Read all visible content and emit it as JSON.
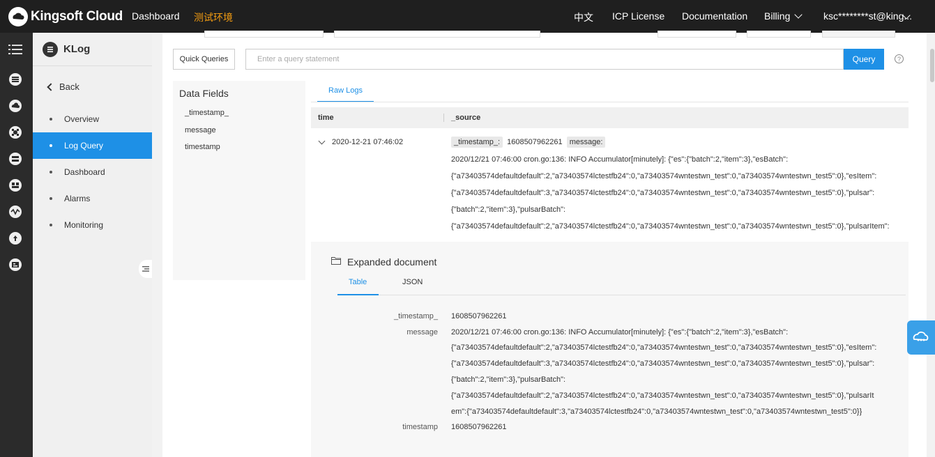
{
  "topbar": {
    "brand": "Kingsoft Cloud",
    "dashboard": "Dashboard",
    "env": "测试环境",
    "lang": "中文",
    "icp": "ICP License",
    "docs": "Documentation",
    "billing": "Billing",
    "user": "ksc********st@king..."
  },
  "sidebar": {
    "app_title": "KLog",
    "back": "Back",
    "items": [
      "Overview",
      "Log Query",
      "Dashboard",
      "Alarms",
      "Monitoring"
    ],
    "active_index": 1
  },
  "query": {
    "quick_queries": "Quick Queries",
    "placeholder": "Enter a query statement",
    "query_button": "Query",
    "help": "?"
  },
  "fields": {
    "title": "Data Fields",
    "items": [
      "_timestamp_",
      "message",
      "timestamp"
    ]
  },
  "results": {
    "tab": "Raw Logs",
    "col_time": "time",
    "col_source": "_source",
    "row": {
      "time": "2020-12-21 07:46:02",
      "tag_timestamp": "_timestamp_:",
      "timestamp_value": "1608507962261",
      "tag_message": "message:",
      "lines": [
        "2020/12/21 07:46:00 cron.go:136: INFO Accumulator[minutely]: {\"es\":{\"batch\":2,\"item\":3},\"esBatch\":",
        "{\"a73403574defaultdefault\":2,\"a73403574lctestfb24\":0,\"a73403574wntestwn_test\":0,\"a73403574wntestwn_test5\":0},\"esItem\":",
        "{\"a73403574defaultdefault\":3,\"a73403574lctestfb24\":0,\"a73403574wntestwn_test\":0,\"a73403574wntestwn_test5\":0},\"pulsar\":",
        "{\"batch\":2,\"item\":3},\"pulsarBatch\":",
        "{\"a73403574defaultdefault\":2,\"a73403574lctestfb24\":0,\"a73403574wntestwn_test\":0,\"a73403574wntestwn_test5\":0},\"pulsarItem\":"
      ]
    }
  },
  "expanded": {
    "title": "Expanded document",
    "tab_table": "Table",
    "tab_json": "JSON",
    "timestamp_key": "_timestamp_",
    "timestamp_value": "1608507962261",
    "message_key": "message",
    "message_lines": [
      "2020/12/21 07:46:00 cron.go:136: INFO Accumulator[minutely]: {\"es\":{\"batch\":2,\"item\":3},\"esBatch\":",
      "{\"a73403574defaultdefault\":2,\"a73403574lctestfb24\":0,\"a73403574wntestwn_test\":0,\"a73403574wntestwn_test5\":0},\"esItem\":",
      "{\"a73403574defaultdefault\":3,\"a73403574lctestfb24\":0,\"a73403574wntestwn_test\":0,\"a73403574wntestwn_test5\":0},\"pulsar\":",
      "{\"batch\":2,\"item\":3},\"pulsarBatch\":",
      "{\"a73403574defaultdefault\":2,\"a73403574lctestfb24\":0,\"a73403574wntestwn_test\":0,\"a73403574wntestwn_test5\":0},\"pulsarIt",
      "em\":{\"a73403574defaultdefault\":3,\"a73403574lctestfb24\":0,\"a73403574wntestwn_test\":0,\"a73403574wntestwn_test5\":0}}"
    ],
    "ts2_key": "timestamp",
    "ts2_value": "1608507962261"
  },
  "colors": {
    "accent": "#1e90e6",
    "topbar": "#1f1f1f",
    "env": "#f39c12"
  }
}
